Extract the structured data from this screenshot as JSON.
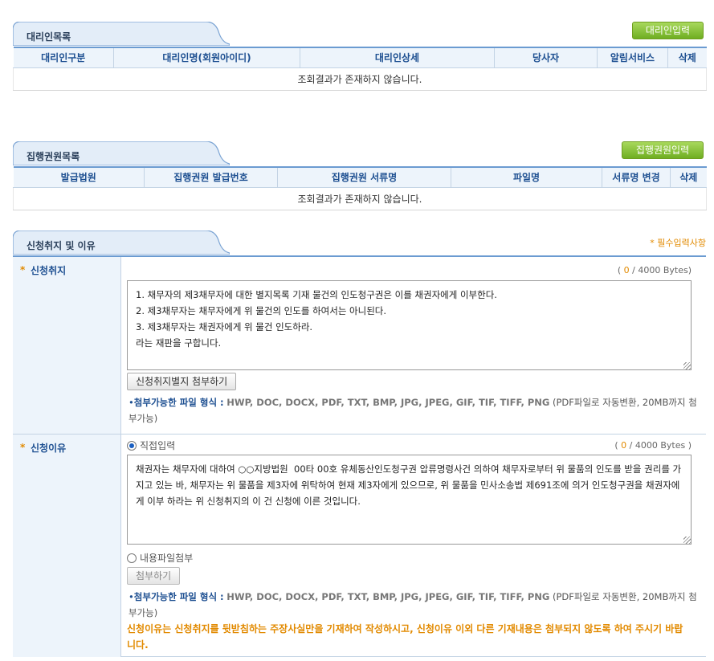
{
  "agent_section": {
    "title": "대리인목록",
    "add_button": "대리인입력",
    "columns": [
      "대리인구분",
      "대리인명(회원아이디)",
      "대리인상세",
      "당사자",
      "알림서비스",
      "삭제"
    ],
    "empty_message": "조회결과가 존재하지 않습니다."
  },
  "enforcement_section": {
    "title": "집행권원목록",
    "add_button": "집행권원입력",
    "columns": [
      "발급법원",
      "집행권원 발급번호",
      "집행권원 서류명",
      "파일명",
      "서류명 변경",
      "삭제"
    ],
    "empty_message": "조회결과가 존재하지 않습니다."
  },
  "application_section": {
    "title": "신청취지 및 이유",
    "required_note": "* 필수입력사항",
    "purpose": {
      "label": "신청취지",
      "byte_open": "(",
      "byte_count": "0",
      "byte_close": "/ 4000 Bytes)",
      "text": "1. 채무자의 제3채무자에 대한 별지목록 기재 물건의 인도청구권은 이를 채권자에게 이부한다.\n2. 제3채무자는 채무자에게 위 물건의 인도를 하여서는 아니된다.\n3. 제3채무자는 채권자에게 위 물건 인도하라.\n라는 재판을 구합니다.",
      "attach_button": "신청취지별지 첨부하기",
      "file_note_label": "첨부가능한 파일 형식 :",
      "file_formats": "HWP, DOC, DOCX, PDF, TXT, BMP, JPG, JPEG, GIF, TIF, TIFF, PNG",
      "file_note_tail": "(PDF파일로 자동변환, 20MB까지 첨부가능)"
    },
    "reason": {
      "label": "신청이유",
      "option_direct": "직접입력",
      "option_direct_selected": true,
      "byte_open": "(",
      "byte_count": "0",
      "byte_close": "/ 4000 Bytes )",
      "text": "채권자는 채무자에 대하여 ○○지방법원  00타 00호 유체동산인도청구권 압류명령사건 의하여 채무자로부터 위 물품의 인도를 받을 권리를 가지고 있는 바, 채무자는 위 물품을 제3자에 위탁하여 현재 제3자에게 있으므로, 위 물품을 민사소송법 제691조에 의거 인도청구권을 채권자에게 이부 하라는 위 신청취지의 이 건 신청에 이른 것입니다.",
      "option_file": "내용파일첨부",
      "attach_button": "첨부하기",
      "file_note_label": "첨부가능한 파일 형식 :",
      "file_formats": "HWP, DOC, DOCX, PDF, TXT, BMP, JPG, JPEG, GIF, TIF, TIFF, PNG",
      "file_note_tail": "(PDF파일로 자동변환, 20MB까지 첨부가능)",
      "warning": "신청이유는 신청취지를 뒷받침하는 주장사실만을 기재하여 작성하시고, 신청이유 이외 다른 기재내용은 첨부되지 않도록 하여 주시기 바랍니다."
    }
  },
  "colors": {
    "accent": "#6b9bd1",
    "header_bg": "#edf4fb",
    "header_text": "#1d4f91",
    "required": "#e28a00",
    "green_button": "#6fae22"
  }
}
